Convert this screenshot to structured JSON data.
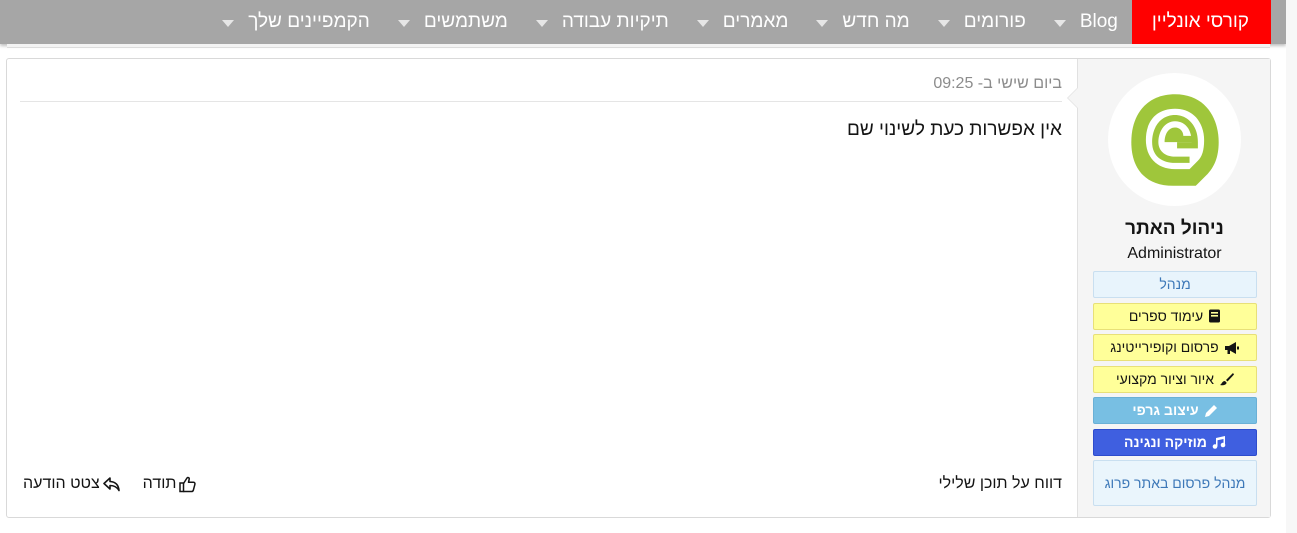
{
  "nav": {
    "items": [
      {
        "label": "קורסי אונליין",
        "highlight": true,
        "dropdown": false
      },
      {
        "label": "Blog",
        "dropdown": true
      },
      {
        "label": "פורומים",
        "dropdown": true
      },
      {
        "label": "מה חדש",
        "dropdown": true
      },
      {
        "label": "מאמרים",
        "dropdown": true
      },
      {
        "label": "תיקיות עבודה",
        "dropdown": true
      },
      {
        "label": "משתמשים",
        "dropdown": true
      },
      {
        "label": "הקמפיינים שלך",
        "dropdown": true
      }
    ]
  },
  "post": {
    "timestamp": "ביום שישי ב- 09:25",
    "body": "אין אפשרות כעת לשינוי שם",
    "report_label": "דווח על תוכן שלילי",
    "like_label": "תודה",
    "quote_label": "צטט הודעה"
  },
  "user": {
    "name": "ניהול האתר",
    "title": "Administrator",
    "avatar_icon": "site-logo-icon",
    "badges": [
      {
        "label": "מנהל",
        "style": "blue-light",
        "icon": ""
      },
      {
        "label": "עימוד ספרים",
        "style": "yellow",
        "icon": "book-icon"
      },
      {
        "label": "פרסום וקופירייטינג",
        "style": "yellow",
        "icon": "megaphone-icon"
      },
      {
        "label": "איור וציור מקצועי",
        "style": "yellow",
        "icon": "brush-icon"
      },
      {
        "label": "עיצוב גרפי",
        "style": "sky",
        "icon": "pencil-icon"
      },
      {
        "label": "מוזיקה ונגינה",
        "style": "royal",
        "icon": "music-icon"
      },
      {
        "label": "מנהל פרסום באתר פרוג",
        "style": "pale",
        "icon": ""
      }
    ]
  },
  "colors": {
    "nav_bg": "#a6a6a6",
    "nav_highlight": "#ff0000",
    "logo_green": "#9fc63b"
  }
}
